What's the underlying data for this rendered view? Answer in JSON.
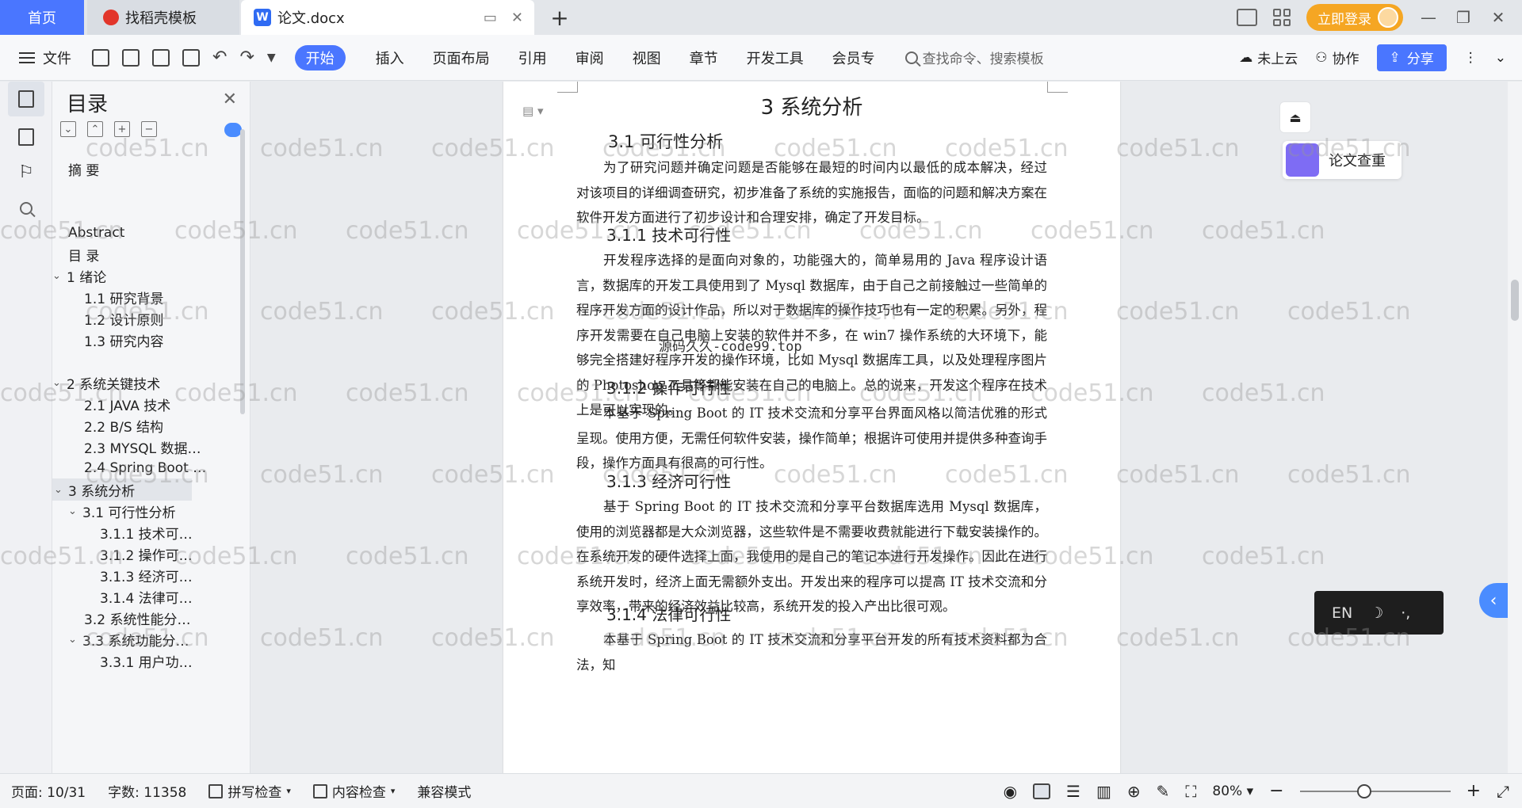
{
  "tabs": {
    "home": "首页",
    "daoke": "找稻壳模板",
    "doc": "论文.docx",
    "add": "+"
  },
  "titlebar": {
    "login": "立即登录"
  },
  "ribbon": {
    "file": "文件",
    "menus": [
      "开始",
      "插入",
      "页面布局",
      "引用",
      "审阅",
      "视图",
      "章节",
      "开发工具",
      "会员专"
    ],
    "search_placeholder": "查找命令、搜索模板",
    "cloud": "未上云",
    "collab": "协作",
    "share": "分享"
  },
  "toc": {
    "title": "目录",
    "items": [
      {
        "label": "摘 要",
        "level": 1
      },
      {
        "label": "Abstract",
        "level": 1
      },
      {
        "label": "目 录",
        "level": 1
      },
      {
        "label": "1 绪论",
        "level": 1
      },
      {
        "label": "1.1 研究背景",
        "level": 2
      },
      {
        "label": "1.2 设计原则",
        "level": 2
      },
      {
        "label": "1.3 研究内容",
        "level": 2
      },
      {
        "label": "2 系统关键技术",
        "level": 1
      },
      {
        "label": "2.1 JAVA 技术",
        "level": 2
      },
      {
        "label": "2.2 B/S 结构",
        "level": 2
      },
      {
        "label": "2.3 MYSQL 数据…",
        "level": 2
      },
      {
        "label": "2.4 Spring Boot …",
        "level": 2
      },
      {
        "label": "3 系统分析",
        "level": 1
      },
      {
        "label": "3.1 可行性分析",
        "level": 2
      },
      {
        "label": "3.1.1 技术可…",
        "level": 3
      },
      {
        "label": "3.1.2 操作可…",
        "level": 3
      },
      {
        "label": "3.1.3 经济可…",
        "level": 3
      },
      {
        "label": "3.1.4 法律可…",
        "level": 3
      },
      {
        "label": "3.2 系统性能分…",
        "level": 2
      },
      {
        "label": "3.3 系统功能分…",
        "level": 2
      },
      {
        "label": "3.3.1 用户功…",
        "level": 3
      }
    ]
  },
  "document": {
    "h1": "3 系统分析",
    "h2_1": "3.1 可行性分析",
    "p_intro": "为了研究问题并确定问题是否能够在最短的时间内以最低的成本解决，经过对该项目的详细调查研究，初步准备了系统的实施报告，面临的问题和解决方案在软件开发方面进行了初步设计和合理安排，确定了开发目标。",
    "h3_1": "3.1.1 技术可行性",
    "p_tech": "开发程序选择的是面向对象的，功能强大的，简单易用的 Java 程序设计语言，数据库的开发工具使用到了 Mysql 数据库，由于自己之前接触过一些简单的程序开发方面的设计作品，所以对于数据库的操作技巧也有一定的积累。另外，程序开发需要在自己电脑上安装的软件并不多，在 win7 操作系统的大环境下，能够完全搭建好程序开发的操作环境，比如 Mysql 数据库工具，以及处理程序图片的 Photoshop 工具等都能安装在自己的电脑上。总的说来，开发这个程序在技术上是可以实现的。",
    "overlay": "源码久久-code99.top",
    "h3_2": "3.1.2 操作可行性",
    "p_op": "本基于 Spring  Boot 的 IT 技术交流和分享平台界面风格以简洁优雅的形式呈现。使用方便，无需任何软件安装，操作简单；根据许可使用并提供多种查询手段，操作方面具有很高的可行性。",
    "h3_3": "3.1.3 经济可行性",
    "p_econ": "基于 Spring  Boot 的 IT 技术交流和分享平台数据库选用 Mysql 数据库，使用的浏览器都是大众浏览器，这些软件是不需要收费就能进行下载安装操作的。在系统开发的硬件选择上面，我使用的是自己的笔记本进行开发操作。因此在进行系统开发时，经济上面无需额外支出。开发出来的程序可以提高 IT 技术交流和分享效率，带来的经济效益比较高，系统开发的投入产出比很可观。",
    "h3_4": "3.1.4 法律可行性",
    "p_law": "本基于 Spring  Boot 的 IT 技术交流和分享平台开发的所有技术资料都为合法，知"
  },
  "floating": {
    "check": "论文查重",
    "ime_lang": "EN",
    "ime_moon": "☽",
    "ime_punct": "·,"
  },
  "watermark": "code51.cn",
  "status": {
    "page": "页面: 10/31",
    "words": "字数: 11358",
    "spell": "拼写检查",
    "content_check": "内容检查",
    "compat": "兼容模式",
    "zoom": "80%"
  }
}
